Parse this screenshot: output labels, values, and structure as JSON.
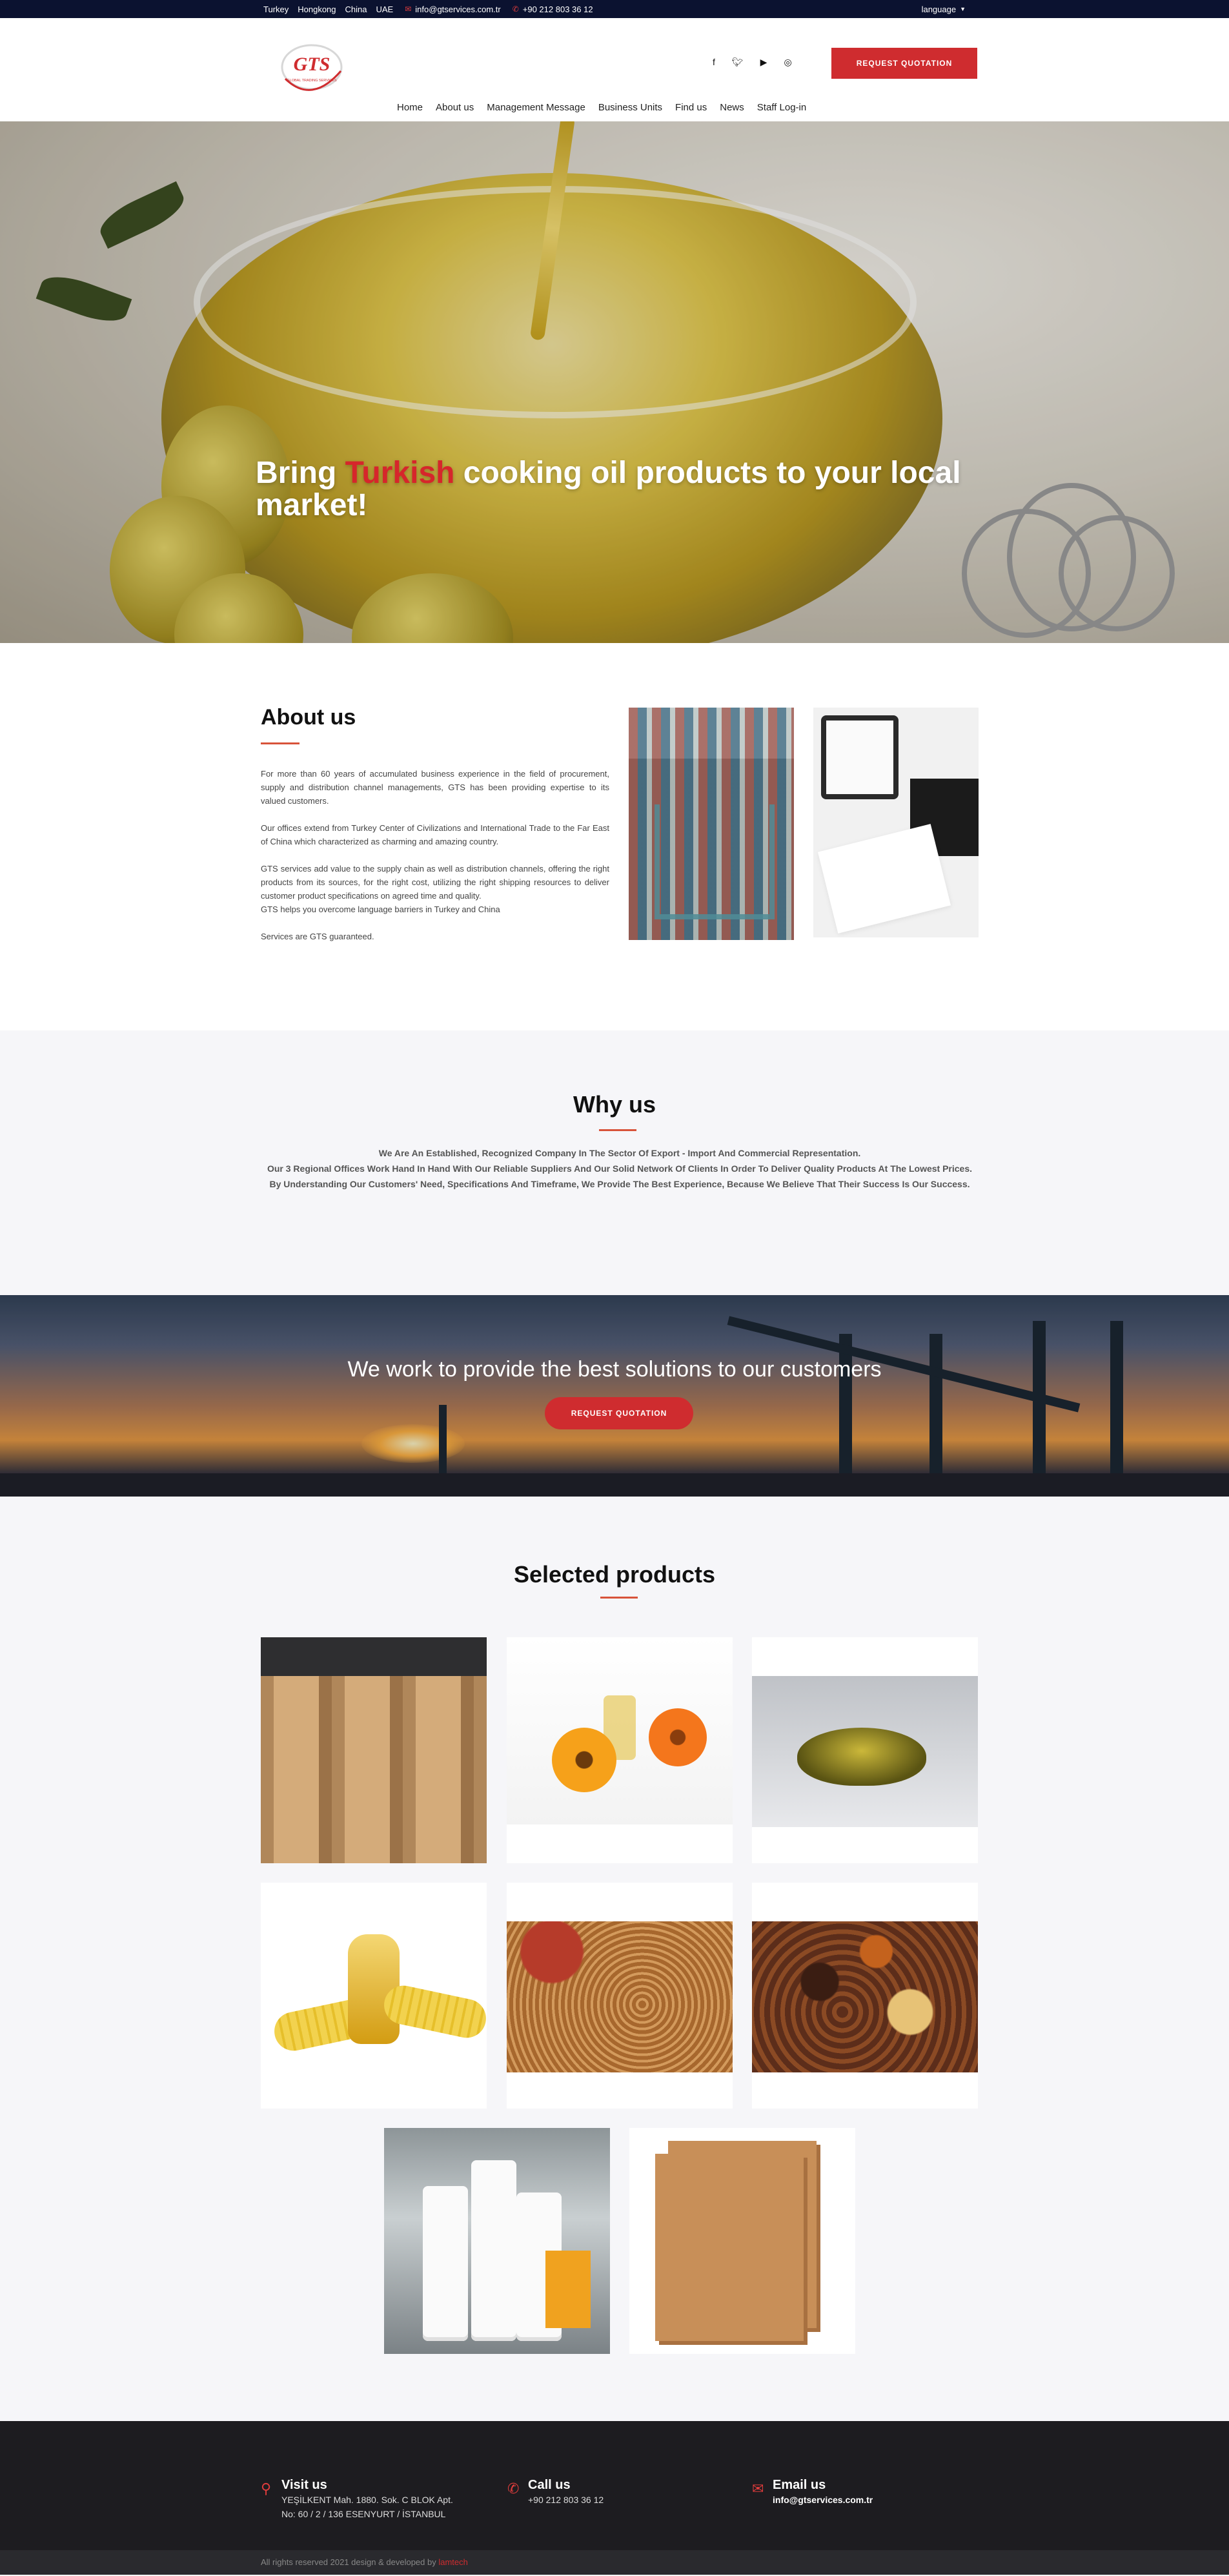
{
  "topbar": {
    "locations": [
      "Turkey",
      "Hongkong",
      "China",
      "UAE"
    ],
    "email": "info@gtservices.com.tr",
    "phone": "+90 212 803 36 12",
    "language": "language"
  },
  "header": {
    "logo_text": "GTS",
    "logo_subtext": "GLOBAL TRADING SERVICES",
    "quote_button": "REQUEST QUOTATION",
    "social_icons": [
      "facebook-icon",
      "twitter-icon",
      "youtube-icon",
      "instagram-icon"
    ],
    "nav": [
      "Home",
      "About us",
      "Management Message",
      "Business Units",
      "Find us",
      "News",
      "Staff Log-in"
    ]
  },
  "hero": {
    "title_before": "Bring ",
    "title_highlight": "Turkish",
    "title_after": " cooking oil products to your local market!",
    "slides": 4,
    "active_slide": 2
  },
  "about": {
    "title": "About us",
    "paragraphs": [
      "For more than 60 years of accumulated business experience in the field of procurement, supply and distribution channel managements, GTS has been providing expertise to its valued customers.",
      "Our offices extend from Turkey Center of Civilizations and International Trade to the Far East of China which characterized as charming and amazing country.",
      "GTS services add value to the supply chain as well as distribution channels, offering the right products from its sources, for the right cost, utilizing the right shipping resources to deliver customer product specifications on agreed time and quality.",
      "GTS helps you overcome language barriers in Turkey and China",
      "Services are GTS guaranteed."
    ]
  },
  "why": {
    "title": "Why us",
    "lines": [
      "We Are An Established, Recognized Company In The Sector Of Export - Import And Commercial Representation.",
      "Our 3 Regional Offices Work Hand In Hand With Our Reliable Suppliers And Our Solid Network Of Clients In Order To Deliver Quality Products At The Lowest Prices.",
      "By Understanding Our Customers' Need, Specifications And Timeframe, We Provide The Best Experience, Because We Believe That Their Success Is Our Success."
    ]
  },
  "banner": {
    "title": "We work to provide the best solutions to our customers",
    "button": "REQUEST QUOTATION"
  },
  "products": {
    "title": "Selected products"
  },
  "footer": {
    "visit_title": "Visit us",
    "visit_line1": "YEŞİLKENT Mah. 1880. Sok. C BLOK Apt.",
    "visit_line2": "No: 60 / 2 / 136 ESENYURT / İSTANBUL",
    "call_title": "Call us",
    "call_value": "+90 212 803 36 12",
    "email_title": "Email us",
    "email_value": "info@gtservices.com.tr",
    "copyright": "All rights reserved 2021 design & developed by ",
    "developer": "lamtech"
  },
  "colors": {
    "accent_red": "#cf2c2f",
    "topbar_bg": "#0b1230",
    "footer_bg": "#1d1c20",
    "accent_line": "#d8533a"
  }
}
